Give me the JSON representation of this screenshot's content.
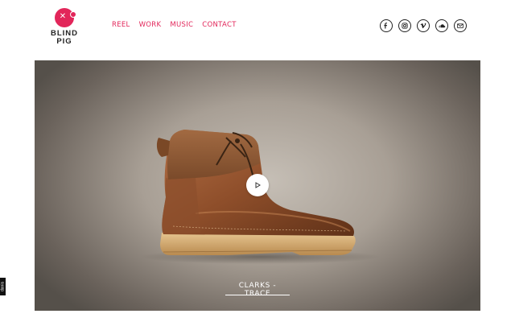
{
  "brand": {
    "line1": "BLIND",
    "line2": "PIG",
    "color": "#e2265a"
  },
  "nav": [
    {
      "label": "REEL"
    },
    {
      "label": "WORK"
    },
    {
      "label": "MUSIC"
    },
    {
      "label": "CONTACT"
    }
  ],
  "social_icons": [
    "facebook-icon",
    "instagram-icon",
    "vimeo-icon",
    "soundcloud-icon",
    "email-icon"
  ],
  "hero": {
    "caption": "CLARKS - TRACE"
  },
  "side_badge": {
    "label": "danis"
  }
}
